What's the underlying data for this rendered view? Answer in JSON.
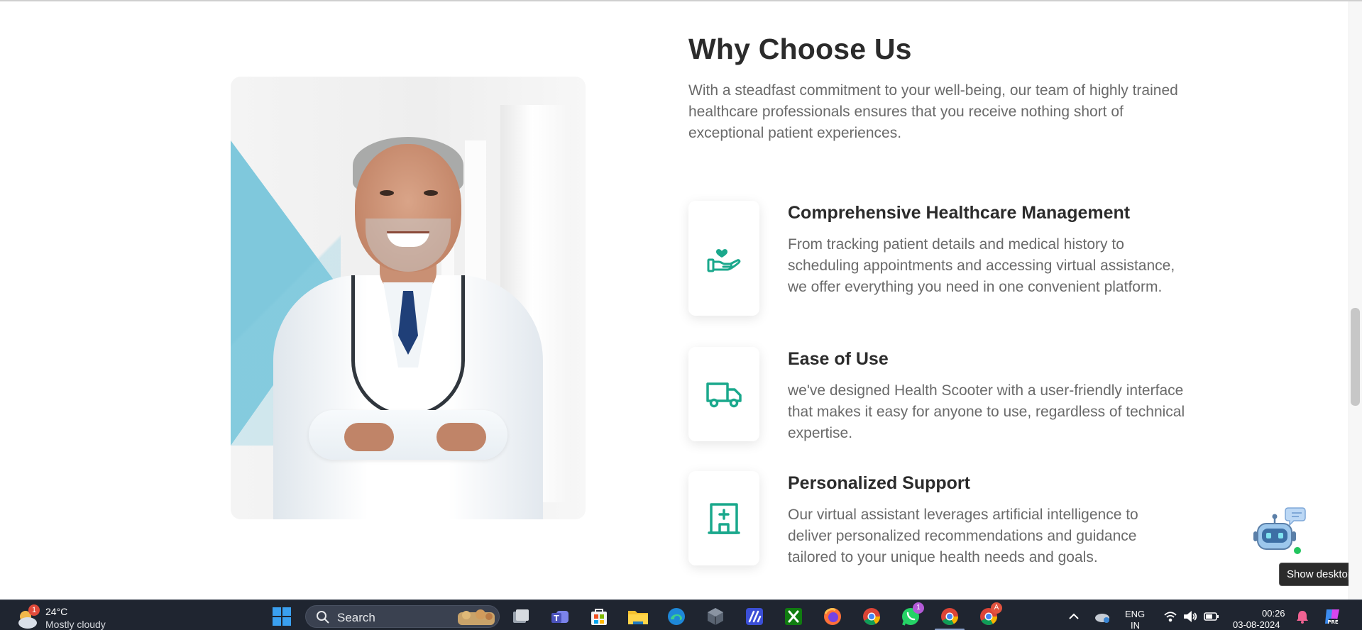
{
  "section": {
    "title": "Why Choose Us",
    "intro": "With a steadfast commitment to your well-being, our team of highly trained healthcare professionals ensures that you receive nothing short of exceptional patient experiences."
  },
  "features": [
    {
      "title": "Comprehensive Healthcare Management",
      "description": "From tracking patient details and medical history to scheduling appointments and accessing virtual assistance, we offer everything you need in one convenient platform.",
      "icon": "hand-heart-icon"
    },
    {
      "title": "Ease of Use",
      "description": "we've designed Health Scooter with a user-friendly interface that makes it easy for anyone to use, regardless of technical expertise.",
      "icon": "truck-icon"
    },
    {
      "title": "Personalized Support",
      "description": "Our virtual assistant leverages artificial intelligence to deliver personalized recommendations and guidance tailored to your unique health needs and goals.",
      "icon": "hospital-icon"
    }
  ],
  "tooltip": "Show desktop",
  "colors": {
    "accent": "#1aa88c",
    "heading": "#2b2b2b",
    "body": "#6a6a6a",
    "taskbar": "#1f2530"
  },
  "taskbar": {
    "weather": {
      "badge": "1",
      "temp": "24°C",
      "condition": "Mostly cloudy"
    },
    "search_label": "Search",
    "whatsapp_badge": "1",
    "chrome_badge": "A",
    "tray": {
      "language": "ENG",
      "region": "IN",
      "time": "00:26",
      "date": "03-08-2024"
    }
  }
}
